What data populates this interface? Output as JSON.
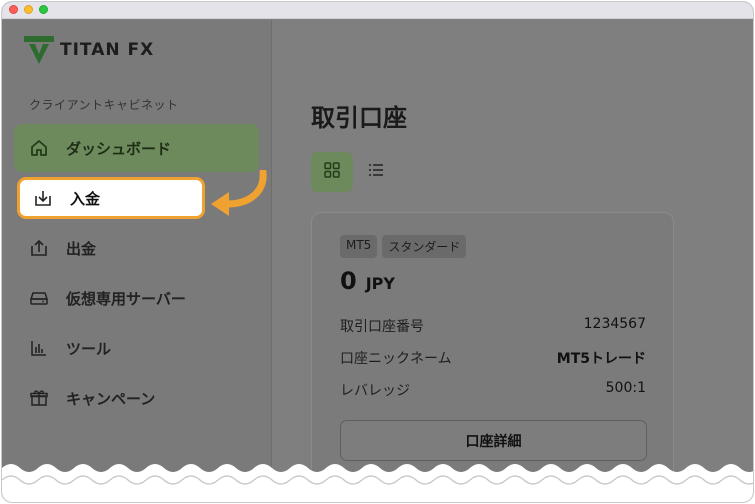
{
  "brand": {
    "logo_text": "TITAN FX",
    "accent_color": "#2e7d32"
  },
  "sidebar": {
    "section_label": "クライアントキャビネット",
    "items": [
      {
        "label": "ダッシュボード",
        "icon": "home-icon",
        "state": "active"
      },
      {
        "label": "入金",
        "icon": "download-icon",
        "state": "highlighted"
      },
      {
        "label": "出金",
        "icon": "upload-icon",
        "state": "default"
      },
      {
        "label": "仮想専用サーバー",
        "icon": "server-icon",
        "state": "default"
      },
      {
        "label": "ツール",
        "icon": "chart-bars-icon",
        "state": "default"
      },
      {
        "label": "キャンペーン",
        "icon": "gift-icon",
        "state": "default"
      }
    ]
  },
  "main": {
    "title": "取引口座",
    "view_toggle": {
      "grid_icon": "grid-icon",
      "list_icon": "list-icon",
      "selected": "grid"
    },
    "account_card": {
      "badges": [
        "MT5",
        "スタンダード"
      ],
      "balance_value": "0",
      "balance_currency": "JPY",
      "rows": [
        {
          "label": "取引口座番号",
          "value": "1234567"
        },
        {
          "label": "口座ニックネーム",
          "value": "MT5トレード"
        },
        {
          "label": "レバレッジ",
          "value": "500:1"
        }
      ],
      "detail_button": "口座詳細"
    }
  },
  "annotation": {
    "arrow_color": "#f0a230"
  }
}
